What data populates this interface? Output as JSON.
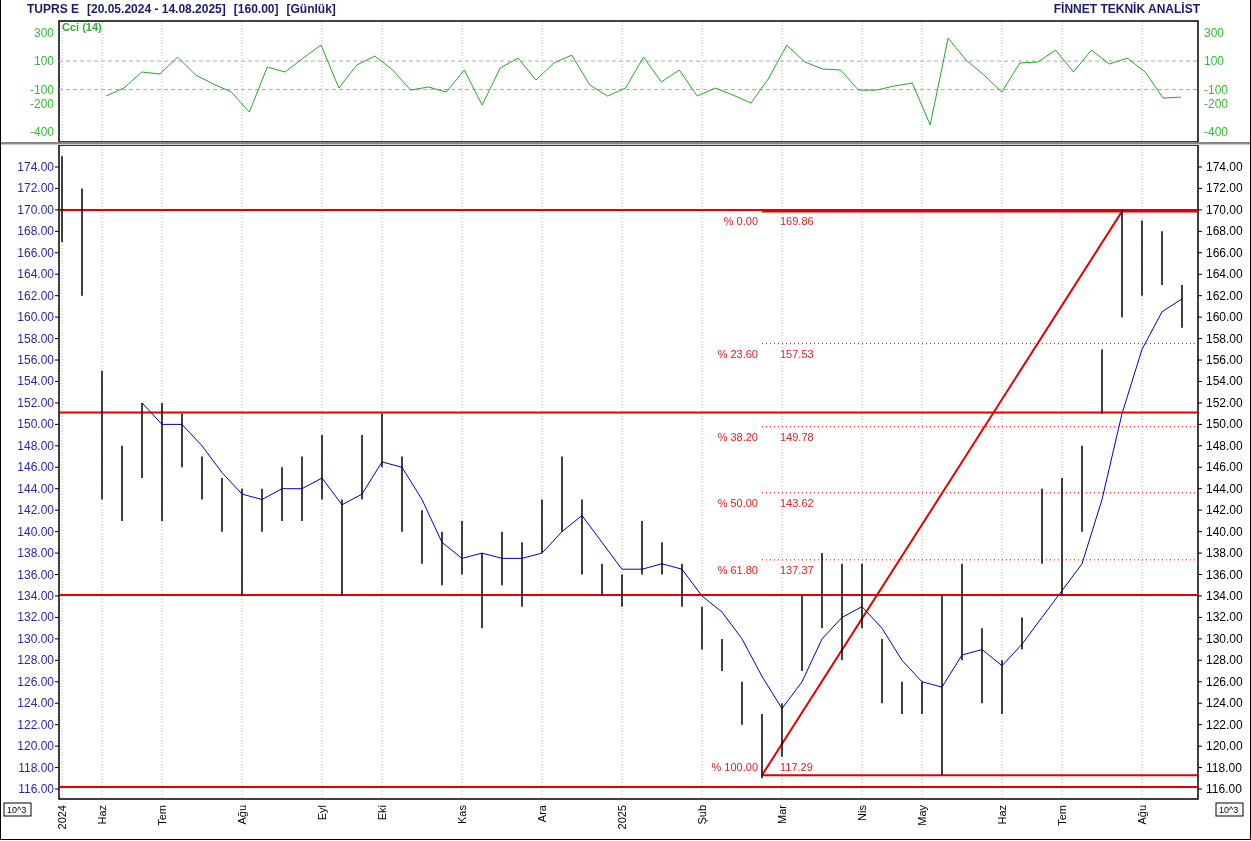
{
  "header": {
    "title_parts": [
      "TUPRS E",
      "[20.05.2024 - 14.08.2025]",
      "[160.00]",
      "[Günlük]"
    ],
    "brand": "FİNNET TEKNİK ANALİST"
  },
  "cci_panel": {
    "chart_data": {
      "type": "line",
      "categories": [
        null,
        null,
        null,
        null,
        null,
        null,
        null,
        null,
        null,
        null,
        null,
        null,
        null,
        null,
        null,
        null,
        null,
        null,
        null,
        null,
        null,
        null,
        null,
        null,
        null,
        null,
        null,
        null,
        null,
        null,
        null,
        null,
        null,
        null,
        null,
        null,
        null,
        null,
        null,
        null,
        null,
        null,
        null,
        null,
        null,
        null,
        null,
        null,
        null,
        null,
        null,
        null,
        null,
        null,
        null,
        null,
        null,
        null,
        null,
        null,
        null
      ],
      "series": [
        {
          "name": "Cci (14)",
          "color": "#22aa22",
          "values": [
            -146,
            -89,
            23,
            9,
            128,
            2,
            -61,
            -118,
            -258,
            58,
            23,
            121,
            212,
            -89,
            72,
            135,
            37,
            -104,
            -82,
            -118,
            37,
            -209,
            51,
            121,
            -33,
            86,
            142,
            -68,
            -146,
            -89,
            128,
            -47,
            37,
            -146,
            -89,
            -139,
            -195,
            -19,
            212,
            93,
            44,
            37,
            -104,
            -104,
            -75,
            -54,
            -349,
            261,
            107,
            2,
            -118,
            86,
            93,
            177,
            23,
            177,
            79,
            121,
            23,
            -160,
            -153
          ]
        }
      ],
      "grid": true,
      "ylim": [
        -461,
        381
      ],
      "yticks": [
        {
          "value": 300,
          "label": "300"
        },
        {
          "value": 100,
          "label": "100"
        },
        {
          "value": -100,
          "label": "-100"
        },
        {
          "value": -200,
          "label": "-200"
        },
        {
          "value": -400,
          "label": "-400"
        }
      ]
    }
  },
  "price_panel": {
    "scale_labels": [
      "10^3",
      "10^3"
    ],
    "fibonacci": [
      {
        "label": "% 0.00",
        "value": "169.86"
      },
      {
        "label": "% 23.60",
        "value": "157.53"
      },
      {
        "label": "% 38.20",
        "value": "149.78"
      },
      {
        "label": "% 50.00",
        "value": "143.62"
      },
      {
        "label": "% 61.80",
        "value": "137.37"
      },
      {
        "label": "% 100.00",
        "value": "117.29"
      }
    ],
    "chart_data": {
      "type": "line",
      "categories": [
        "2024",
        null,
        "Haz",
        null,
        null,
        "Tem",
        null,
        null,
        null,
        "Ağu",
        null,
        null,
        null,
        "Eyl",
        null,
        null,
        "Eki",
        null,
        null,
        null,
        "Kas",
        null,
        null,
        null,
        "Ara",
        null,
        null,
        null,
        "2025",
        null,
        null,
        null,
        "Şub",
        null,
        null,
        null,
        "Mar",
        null,
        null,
        null,
        "Nis",
        null,
        null,
        "May",
        null,
        null,
        null,
        "Haz",
        null,
        null,
        "Tem",
        null,
        null,
        null,
        "Ağu",
        null,
        null
      ],
      "series": [
        {
          "color": "#0000cc",
          "values": [
            null,
            null,
            null,
            null,
            152,
            150,
            150,
            148,
            145.5,
            143.5,
            143,
            144,
            144,
            145,
            142.5,
            143.5,
            146.5,
            146,
            143,
            139,
            137.5,
            138,
            137.5,
            137.5,
            138,
            140,
            141.5,
            139,
            136.5,
            136.5,
            137,
            136.5,
            134,
            132.5,
            130,
            126.5,
            123.5,
            126,
            130,
            132,
            133,
            131,
            128,
            126,
            125.5,
            128.5,
            129,
            127.5,
            129.5,
            132,
            134.5,
            137,
            143,
            151,
            157,
            160.5,
            161.7
          ]
        }
      ],
      "grid": true,
      "ylim": [
        115.07,
        176.05
      ],
      "yticks": [
        {
          "value": 174,
          "label": "174.00"
        },
        {
          "value": 172,
          "label": "172.00"
        },
        {
          "value": 170,
          "label": "170.00"
        },
        {
          "value": 168,
          "label": "168.00"
        },
        {
          "value": 166,
          "label": "166.00"
        },
        {
          "value": 164,
          "label": "164.00"
        },
        {
          "value": 162,
          "label": "162.00"
        },
        {
          "value": 160,
          "label": "160.00"
        },
        {
          "value": 158,
          "label": "158.00"
        },
        {
          "value": 156,
          "label": "156.00"
        },
        {
          "value": 154,
          "label": "154.00"
        },
        {
          "value": 152,
          "label": "152.00"
        },
        {
          "value": 150,
          "label": "150.00"
        },
        {
          "value": 148,
          "label": "148.00"
        },
        {
          "value": 146,
          "label": "146.00"
        },
        {
          "value": 144,
          "label": "144.00"
        },
        {
          "value": 142,
          "label": "142.00"
        },
        {
          "value": 140,
          "label": "140.00"
        },
        {
          "value": 138,
          "label": "138.00"
        },
        {
          "value": 136,
          "label": "136.00"
        },
        {
          "value": 134,
          "label": "134.00"
        },
        {
          "value": 132,
          "label": "132.00"
        },
        {
          "value": 130,
          "label": "130.00"
        },
        {
          "value": 128,
          "label": "128.00"
        },
        {
          "value": 126,
          "label": "126.00"
        },
        {
          "value": 124,
          "label": "124.00"
        },
        {
          "value": 122,
          "label": "122.00"
        },
        {
          "value": 120,
          "label": "120.00"
        },
        {
          "value": 118,
          "label": "118.00"
        },
        {
          "value": 116,
          "label": "116.00"
        }
      ]
    }
  }
}
